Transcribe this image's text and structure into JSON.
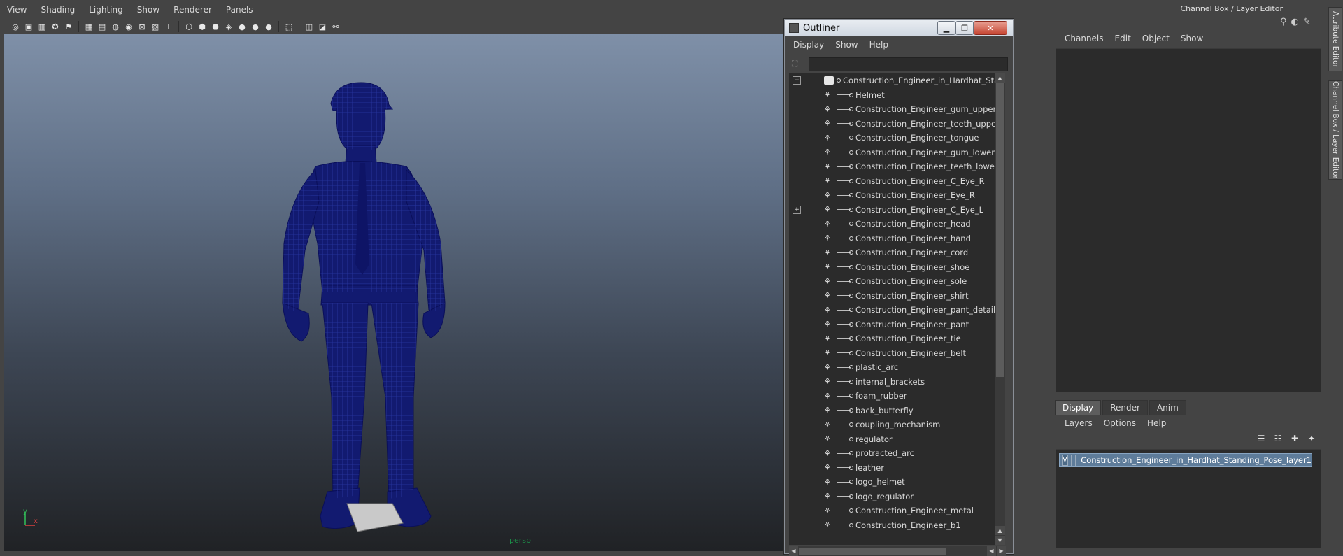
{
  "viewport_menu": [
    "View",
    "Shading",
    "Lighting",
    "Show",
    "Renderer",
    "Panels"
  ],
  "viewport": {
    "camera_label": "persp",
    "axis_y": "y",
    "axis_x": "x"
  },
  "outliner": {
    "title": "Outliner",
    "menu": [
      "Display",
      "Show",
      "Help"
    ],
    "root": "Construction_Engineer_in_Hardhat_Standing_Pose",
    "items": [
      "Helmet",
      "Construction_Engineer_gum_upper",
      "Construction_Engineer_teeth_upper",
      "Construction_Engineer_tongue",
      "Construction_Engineer_gum_lower",
      "Construction_Engineer_teeth_lower",
      "Construction_Engineer_C_Eye_R",
      "Construction_Engineer_Eye_R",
      "Construction_Engineer_C_Eye_L",
      "Construction_Engineer_head",
      "Construction_Engineer_hand",
      "Construction_Engineer_cord",
      "Construction_Engineer_shoe",
      "Construction_Engineer_sole",
      "Construction_Engineer_shirt",
      "Construction_Engineer_pant_detail",
      "Construction_Engineer_pant",
      "Construction_Engineer_tie",
      "Construction_Engineer_belt",
      "plastic_arc",
      "internal_brackets",
      "foam_rubber",
      "back_butterfly",
      "coupling_mechanism",
      "regulator",
      "protracted_arc",
      "leather",
      "logo_helmet",
      "logo_regulator",
      "Construction_Engineer_metal",
      "Construction_Engineer_b1"
    ]
  },
  "channel_box": {
    "title": "Channel Box / Layer Editor",
    "menu": [
      "Channels",
      "Edit",
      "Object",
      "Show"
    ],
    "layer_tabs": [
      "Display",
      "Render",
      "Anim"
    ],
    "layer_menu": [
      "Layers",
      "Options",
      "Help"
    ],
    "layer_visible": "V",
    "layer_name": "Construction_Engineer_in_Hardhat_Standing_Pose_layer1"
  },
  "side_tabs": [
    "Attribute Editor",
    "Channel Box / Layer Editor"
  ]
}
